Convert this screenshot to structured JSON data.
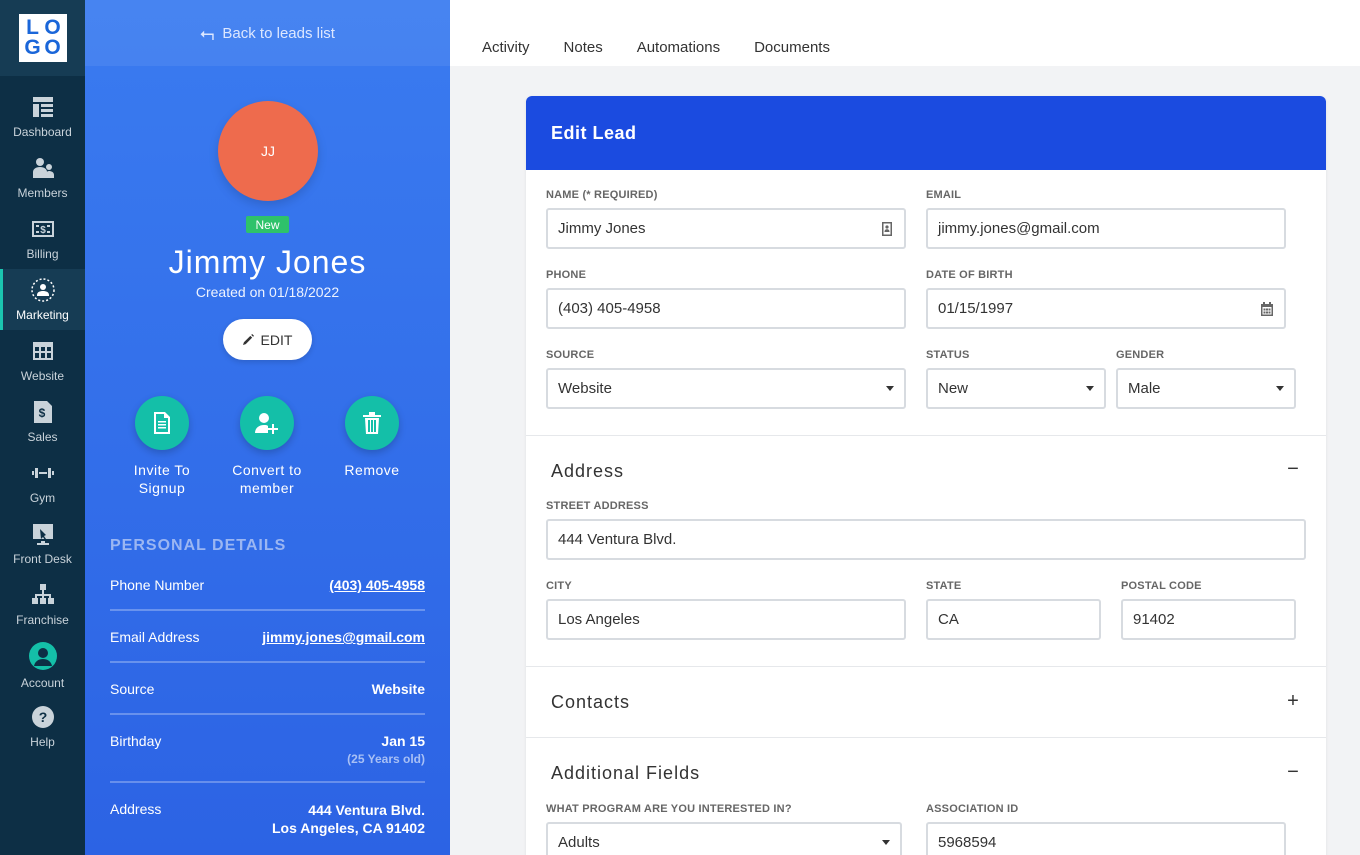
{
  "logo": {
    "letters": [
      "L",
      "O",
      "G",
      "O"
    ]
  },
  "nav": {
    "items": [
      {
        "label": "Dashboard",
        "icon": "dashboard-icon"
      },
      {
        "label": "Members",
        "icon": "members-icon"
      },
      {
        "label": "Billing",
        "icon": "billing-icon"
      },
      {
        "label": "Marketing",
        "icon": "marketing-icon",
        "active": true
      },
      {
        "label": "Website",
        "icon": "website-icon"
      },
      {
        "label": "Sales",
        "icon": "sales-icon"
      },
      {
        "label": "Gym",
        "icon": "gym-icon"
      },
      {
        "label": "Front Desk",
        "icon": "front-desk-icon"
      },
      {
        "label": "Franchise",
        "icon": "franchise-icon"
      },
      {
        "label": "Account",
        "icon": "account-icon"
      },
      {
        "label": "Help",
        "icon": "help-icon"
      }
    ]
  },
  "profile": {
    "back_label": "Back to leads list",
    "initials": "JJ",
    "badge": "New",
    "name": "Jimmy Jones",
    "created": "Created on 01/18/2022",
    "edit_label": "EDIT",
    "actions": {
      "invite": [
        "Invite To",
        "Signup"
      ],
      "convert": [
        "Convert to",
        "member"
      ],
      "remove": [
        "Remove"
      ]
    },
    "details_title": "PERSONAL DETAILS",
    "details": {
      "phone": {
        "label": "Phone Number",
        "value": "(403) 405-4958"
      },
      "email": {
        "label": "Email Address",
        "value": "jimmy.jones@gmail.com"
      },
      "source": {
        "label": "Source",
        "value": "Website"
      },
      "birthday": {
        "label": "Birthday",
        "value": "Jan 15",
        "sub": "(25 Years old)"
      },
      "address": {
        "label": "Address",
        "line1": "444 Ventura Blvd.",
        "line2": "Los Angeles, CA 91402"
      }
    }
  },
  "tabs": [
    "Activity",
    "Notes",
    "Automations",
    "Documents"
  ],
  "form": {
    "title": "Edit Lead",
    "name": {
      "label": "NAME (* REQUIRED)",
      "value": "Jimmy Jones"
    },
    "email": {
      "label": "EMAIL",
      "value": "jimmy.jones@gmail.com"
    },
    "phone": {
      "label": "PHONE",
      "value": "(403) 405-4958"
    },
    "dob": {
      "label": "DATE OF BIRTH",
      "value": "01/15/1997"
    },
    "source": {
      "label": "SOURCE",
      "value": "Website"
    },
    "status": {
      "label": "STATUS",
      "value": "New"
    },
    "gender": {
      "label": "GENDER",
      "value": "Male"
    },
    "address_section": {
      "title": "Address",
      "toggle": "−"
    },
    "street": {
      "label": "STREET ADDRESS",
      "value": "444 Ventura Blvd."
    },
    "city": {
      "label": "CITY",
      "value": "Los Angeles"
    },
    "state": {
      "label": "STATE",
      "value": "CA"
    },
    "postal": {
      "label": "POSTAL CODE",
      "value": "91402"
    },
    "contacts_section": {
      "title": "Contacts",
      "toggle": "+"
    },
    "additional_section": {
      "title": "Additional Fields",
      "toggle": "−"
    },
    "program": {
      "label": "WHAT PROGRAM ARE YOU INTERESTED IN?",
      "value": "Adults"
    },
    "association": {
      "label": "ASSOCIATION ID",
      "value": "5968594"
    }
  },
  "colors": {
    "nav_bg": "#0d2f45",
    "panel_blue": "#2c63e4",
    "header_blue": "#1b4be0",
    "teal": "#14bfa8",
    "avatar": "#ee6b4d",
    "badge_green": "#2ec26a"
  }
}
